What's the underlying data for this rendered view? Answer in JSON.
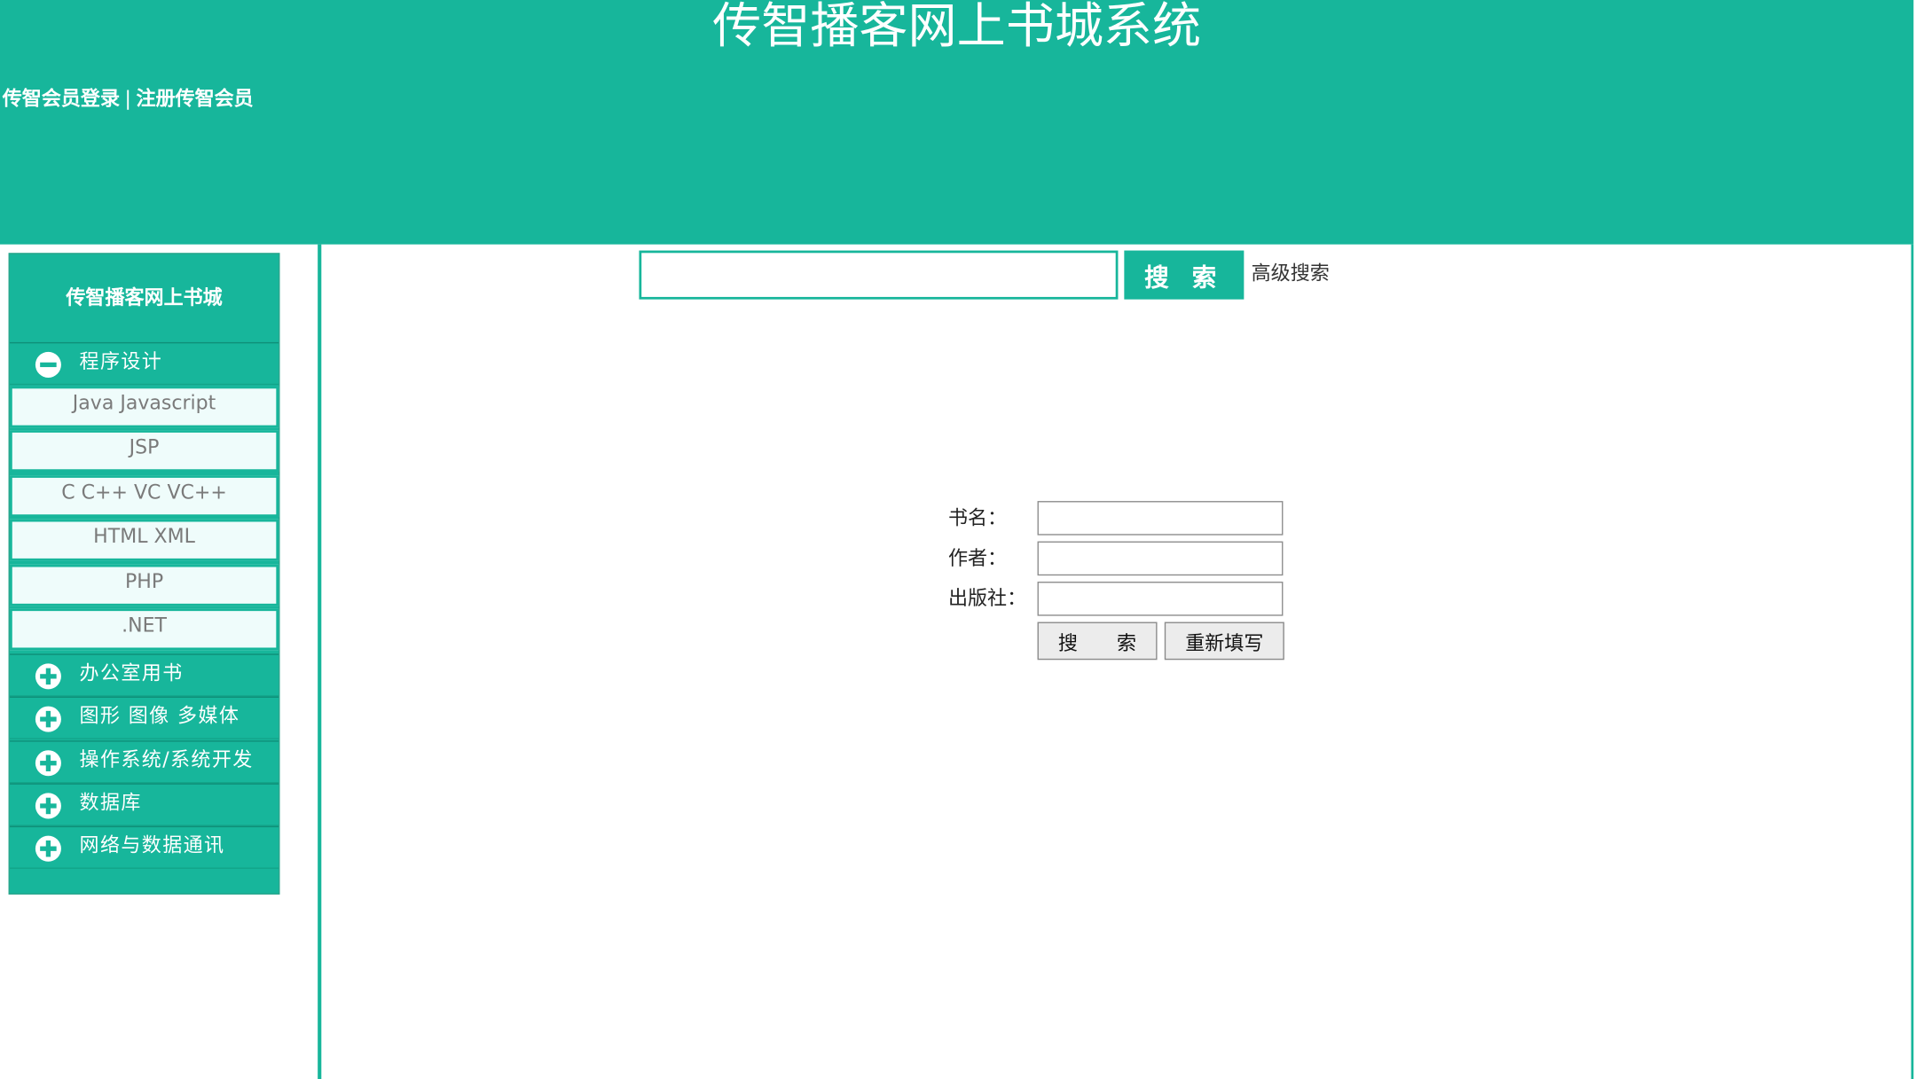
{
  "header": {
    "title": "传智播客网上书城系统",
    "login_link": "传智会员登录",
    "separator": "|",
    "register_link": "注册传智会员"
  },
  "sidebar": {
    "title": "传智播客网上书城",
    "categories": [
      {
        "label": "程序设计",
        "icon": "minus-circle-icon",
        "expanded": true,
        "items": [
          "Java Javascript",
          "JSP",
          "C C++ VC VC++",
          "HTML XML",
          "PHP",
          ".NET"
        ]
      },
      {
        "label": "办公室用书",
        "icon": "plus-circle-icon",
        "expanded": false
      },
      {
        "label": "图形 图像 多媒体",
        "icon": "plus-circle-icon",
        "expanded": false
      },
      {
        "label": "操作系统/系统开发",
        "icon": "plus-circle-icon",
        "expanded": false
      },
      {
        "label": "数据库",
        "icon": "plus-circle-icon",
        "expanded": false
      },
      {
        "label": "网络与数据通讯",
        "icon": "plus-circle-icon",
        "expanded": false
      }
    ]
  },
  "search": {
    "value": "",
    "button_label": "搜 索",
    "advanced_link": "高级搜索"
  },
  "advanced_form": {
    "fields": [
      {
        "label": "书名：",
        "value": ""
      },
      {
        "label": "作者：",
        "value": ""
      },
      {
        "label": "出版社：",
        "value": ""
      }
    ],
    "search_button": "搜　　索",
    "reset_button": "重新填写"
  },
  "colors": {
    "primary": "#17b69b",
    "subitem_bg": "#effcfb",
    "subitem_text": "#7a7a7a"
  }
}
